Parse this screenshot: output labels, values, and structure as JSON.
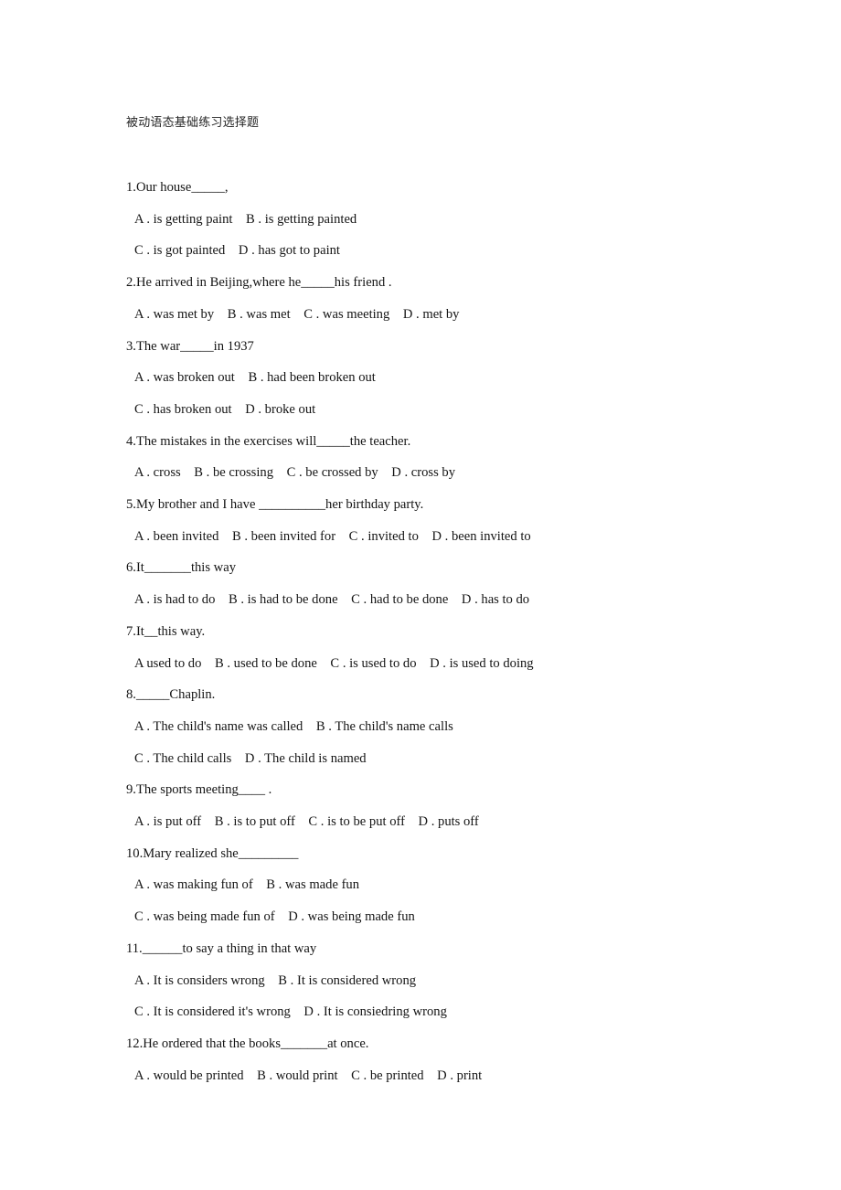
{
  "document": {
    "title": "被动语态基础练习选择题",
    "page_background": "#ffffff",
    "text_color": "#141414",
    "questions": [
      {
        "stem": "1.Our house_____,",
        "option_lines": [
          "A . is getting paint B . is getting painted",
          "C . is got painted D . has got to paint"
        ]
      },
      {
        "stem": "2.He arrived in Beijing,where he_____his friend .",
        "option_lines": [
          "A . was met by B . was met C . was meeting D . met by"
        ]
      },
      {
        "stem": "3.The war_____in 1937",
        "option_lines": [
          "A . was broken out B . had been broken out",
          "C . has broken out D . broke out"
        ]
      },
      {
        "stem": "4.The mistakes in the exercises will_____the teacher.",
        "option_lines": [
          "A . cross B . be crossing C . be crossed by D . cross by"
        ]
      },
      {
        "stem": "5.My brother and I have __________her birthday party.",
        "option_lines": [
          "A . been invited B . been invited for C . invited to D . been invited to"
        ]
      },
      {
        "stem": "6.It_______this way",
        "option_lines": [
          "A . is had to do B . is had to be done C . had to be done D . has to do"
        ]
      },
      {
        "stem": "7.It__this way.",
        "option_lines": [
          "A used to do B . used to be done C . is used to do D . is used to doing"
        ]
      },
      {
        "stem": "8._____Chaplin.",
        "option_lines": [
          "A . The child's name was called B . The child's name calls",
          "C . The child calls D . The child is named"
        ]
      },
      {
        "stem": "9.The sports meeting____ .",
        "option_lines": [
          "A . is put off B . is to put off C . is to be put off D . puts off"
        ]
      },
      {
        "stem": "10.Mary realized she_________",
        "option_lines": [
          "A . was making fun of B . was made fun",
          "C . was being made fun of D . was being made fun"
        ]
      },
      {
        "stem": "11.______to say a thing in that way",
        "option_lines": [
          "A . It is considers wrong B . It is considered wrong",
          "C . It is considered it's wrong D . It is consiedring wrong"
        ]
      },
      {
        "stem": "12.He ordered that the books_______at once.",
        "option_lines": [
          "A . would be printed B . would print C . be printed D . print"
        ]
      }
    ]
  }
}
